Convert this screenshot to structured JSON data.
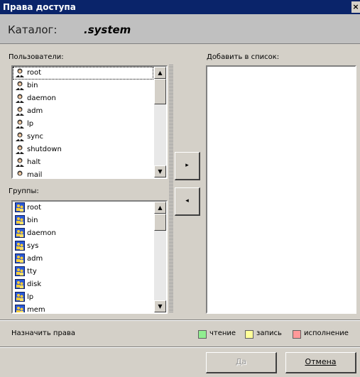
{
  "window": {
    "title": "Права доступа",
    "close_glyph": "×"
  },
  "path": {
    "label": "Каталог:",
    "value": ".system"
  },
  "users": {
    "label": "Пользователи:",
    "items": [
      "root",
      "bin",
      "daemon",
      "adm",
      "lp",
      "sync",
      "shutdown",
      "halt",
      "mail"
    ]
  },
  "groups": {
    "label": "Группы:",
    "items": [
      "root",
      "bin",
      "daemon",
      "sys",
      "adm",
      "tty",
      "disk",
      "lp",
      "mem"
    ]
  },
  "add_list": {
    "label": "Добавить в список:",
    "items": []
  },
  "transfer": {
    "add_glyph": "▸",
    "remove_glyph": "◂"
  },
  "permissions": {
    "label": "Назначить права",
    "read": {
      "label": "чтение",
      "color": "#90ee90"
    },
    "write": {
      "label": "запись",
      "color": "#ffff99"
    },
    "execute": {
      "label": "исполнение",
      "color": "#ff9999"
    }
  },
  "buttons": {
    "ok": "Да",
    "cancel": "Отмена"
  }
}
